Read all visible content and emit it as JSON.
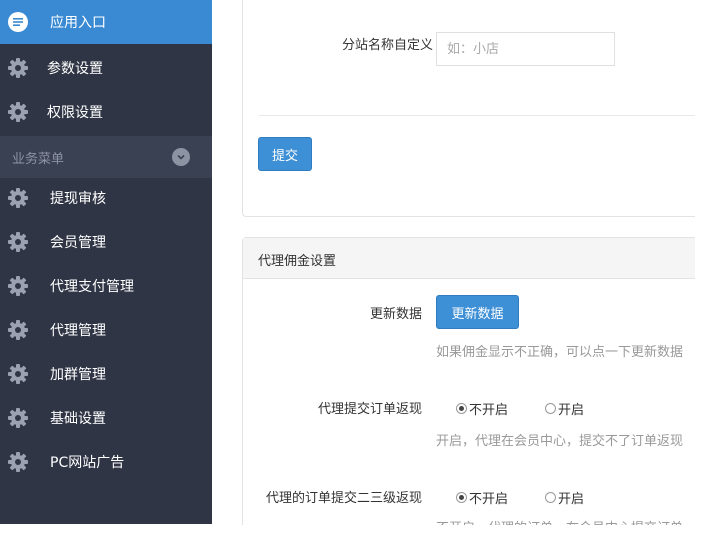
{
  "sidebar": {
    "top_items": [
      {
        "label": "应用入口",
        "icon": "chat-bubble-icon",
        "active": true
      },
      {
        "label": "参数设置",
        "icon": "gear-icon"
      },
      {
        "label": "权限设置",
        "icon": "gear-icon"
      }
    ],
    "group": {
      "label": "业务菜单",
      "icon": "chevron-down-icon"
    },
    "menu_items": [
      {
        "label": "提现审核",
        "icon": "gear-icon"
      },
      {
        "label": "会员管理",
        "icon": "gear-icon"
      },
      {
        "label": "代理支付管理",
        "icon": "gear-icon"
      },
      {
        "label": "代理管理",
        "icon": "gear-icon"
      },
      {
        "label": "加群管理",
        "icon": "gear-icon"
      },
      {
        "label": "基础设置",
        "icon": "gear-icon"
      },
      {
        "label": "PC网站广告",
        "icon": "gear-icon"
      }
    ]
  },
  "form1": {
    "subsite_label": "分站名称自定义",
    "subsite_placeholder": "如：小店",
    "subsite_value": "",
    "submit_label": "提交"
  },
  "panel2": {
    "title": "代理佣金设置",
    "update": {
      "label": "更新数据",
      "button_label": "更新数据",
      "help": "如果佣金显示不正确，可以点一下更新数据"
    },
    "order_return": {
      "label": "代理提交订单返现",
      "options": [
        "不开启",
        "开启"
      ],
      "selected": "不开启",
      "help": "开启，代理在会员中心，提交不了订单返现"
    },
    "second_level_return": {
      "label": "代理的订单提交二三级返现",
      "options": [
        "不开启",
        "开启"
      ],
      "selected": "不开启",
      "help": "不开启，代理的订单，在会员中心提交订单"
    }
  },
  "colors": {
    "sidebar_bg": "#2f3545",
    "active_bg": "#3a8ad3",
    "group_bg": "#3a4152",
    "button_blue": "#3d8fd6"
  }
}
